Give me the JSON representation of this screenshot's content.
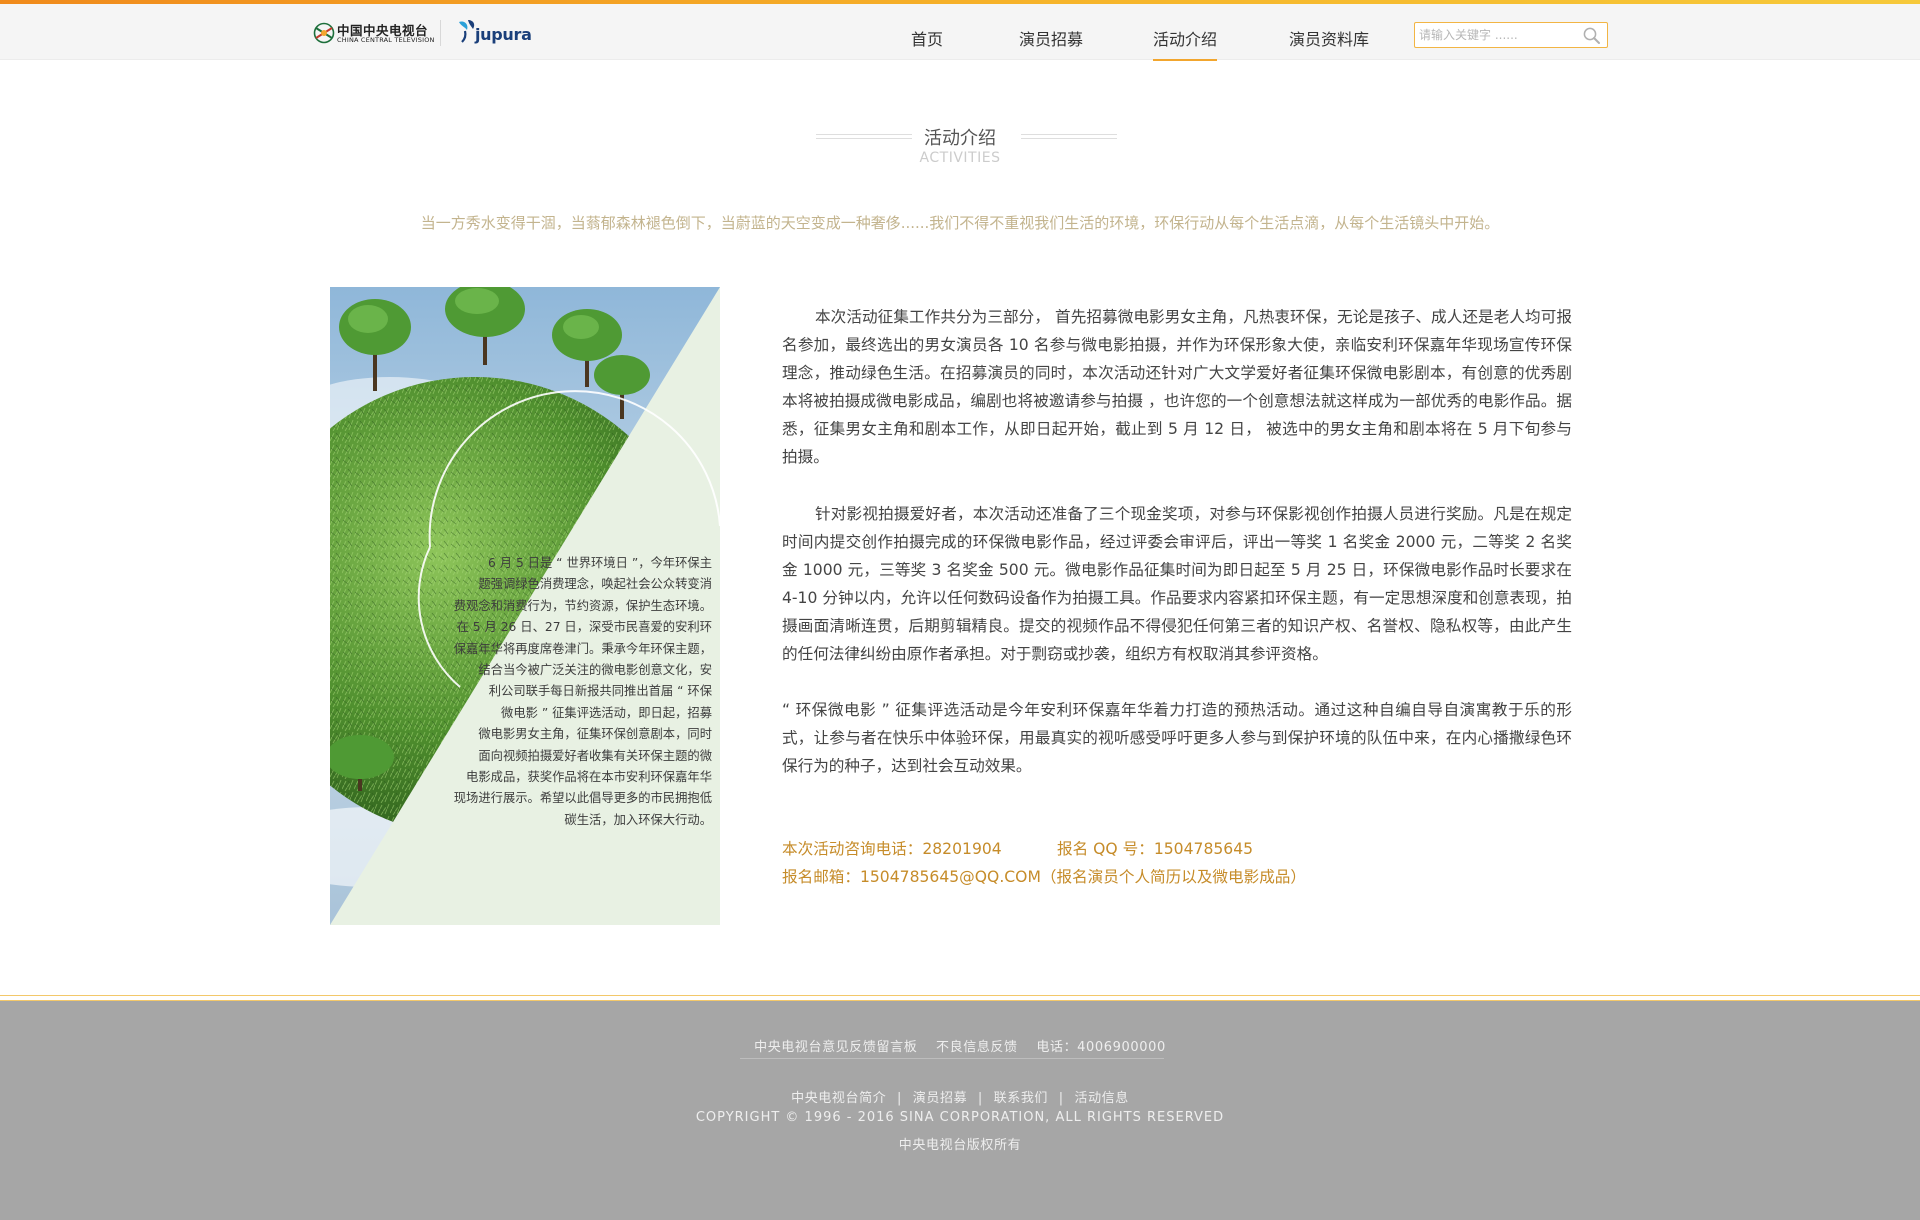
{
  "header": {
    "logo_cctv_cn": "中国中央电视台",
    "logo_cctv_en": "CHINA CENTRAL TELEVISION",
    "logo_jupura": "jupura",
    "nav": [
      {
        "label": "首页"
      },
      {
        "label": "演员招募"
      },
      {
        "label": "活动介绍"
      },
      {
        "label": "演员资料库"
      }
    ],
    "active_nav": "活动介绍",
    "search_placeholder": "请输入关键字 ......",
    "accent_color": "#f2a62e"
  },
  "section": {
    "title": "活动介绍",
    "subtitle": "ACTIVITIES",
    "intro": "当一方秀水变得干涸，当蓊郁森林褪色倒下，当蔚蓝的天空变成一种奢侈......我们不得不重视我们生活的环境，环保行动从每个生活点滴，从每个生活镜头中开始。"
  },
  "poster": {
    "lines": [
      "6 月 5 日是 “ 世界环境日 ”，今年环保主",
      "题强调绿色消费理念，唤起社会公众转变消",
      "费观念和消费行为，节约资源，保护生态环境。",
      "在 5 月 26 日、27 日，深受市民喜爱的安利环",
      "保嘉年华将再度席卷津门。秉承今年环保主题，",
      "结合当今被广泛关注的微电影创意文化，安",
      "利公司联手每日新报共同推出首届 “ 环保",
      "微电影 ” 征集评选活动，即日起，招募",
      "微电影男女主角，征集环保创意剧本，同时",
      "面向视频拍摄爱好者收集有关环保主题的微",
      "电影成品，获奖作品将在本市安利环保嘉年华",
      "现场进行展示。希望以此倡导更多的市民拥抱低",
      "碳生活，加入环保大行动。"
    ]
  },
  "article": {
    "p1": "本次活动征集工作共分为三部分，  首先招募微电影男女主角，凡热衷环保，无论是孩子、成人还是老人均可报名参加，最终选出的男女演员各 10 名参与微电影拍摄，并作为环保形象大使，亲临安利环保嘉年华现场宣传环保理念，推动绿色生活。在招募演员的同时，本次活动还针对广大文学爱好者征集环保微电影剧本，有创意的优秀剧本将被拍摄成微电影成品，编剧也将被邀请参与拍摄 ，也许您的一个创意想法就这样成为一部优秀的电影作品。据悉，征集男女主角和剧本工作，从即日起开始，截止到 5 月 12 日， 被选中的男女主角和剧本将在 5 月下旬参与拍摄。",
    "p2": "针对影视拍摄爱好者，本次活动还准备了三个现金奖项，对参与环保影视创作拍摄人员进行奖励。凡是在规定时间内提交创作拍摄完成的环保微电影作品，经过评委会审评后，评出一等奖 1 名奖金 2000 元，二等奖 2 名奖金 1000 元，三等奖 3 名奖金 500 元。微电影作品征集时间为即日起至 5 月 25 日，环保微电影作品时长要求在 4-10 分钟以内，允许以任何数码设备作为拍摄工具。作品要求内容紧扣环保主题，有一定思想深度和创意表现，拍摄画面清晰连贯，后期剪辑精良。提交的视频作品不得侵犯任何第三者的知识产权、名誉权、隐私权等，由此产生的任何法律纠纷由原作者承担。对于剽窃或抄袭，组织方有权取消其参评资格。",
    "p3": "“ 环保微电影 ” 征集评选活动是今年安利环保嘉年华着力打造的预热活动。通过这种自编自导自演寓教于乐的形式，让参与者在快乐中体验环保，用最真实的视听感受呼吁更多人参与到保护环境的队伍中来，在内心播撒绿色环保行为的种子，达到社会互动效果。"
  },
  "contact": {
    "phone": "本次活动咨询电话：28201904",
    "qq": "报名 QQ 号：1504785645",
    "email": "报名邮箱：1504785645@QQ.COM（报名演员个人简历以及微电影成品）",
    "color": "#c68c2a"
  },
  "footer": {
    "row1": [
      "中央电视台意见反馈留言板",
      "不良信息反馈",
      "电话：4006900000"
    ],
    "row2": [
      "中央电视台简介",
      "演员招募",
      "联系我们",
      "活动信息"
    ],
    "separator": "|",
    "copyright": "COPYRIGHT © 1996 - 2016 SINA CORPORATION, ALL RIGHTS RESERVED",
    "rights": "中央电视台版权所有",
    "bg_color": "#a6a6a6"
  }
}
